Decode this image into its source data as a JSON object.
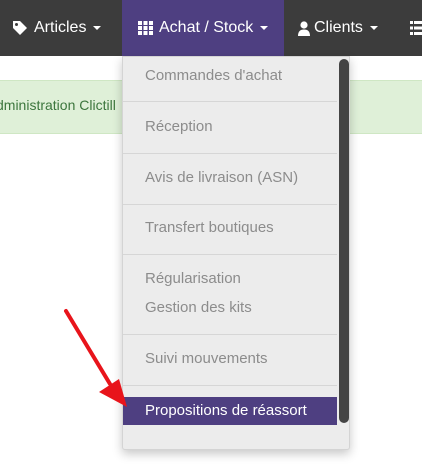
{
  "navbar": {
    "items": [
      {
        "label": "Articles",
        "icon": "tag-icon"
      },
      {
        "label": "Achat / Stock",
        "icon": "grid-icon",
        "active": true
      },
      {
        "label": "Clients",
        "icon": "user-icon"
      },
      {
        "label": "",
        "icon": "list-icon"
      }
    ]
  },
  "alert": {
    "text": "dministration Clictill"
  },
  "dropdown": {
    "items": [
      {
        "label": "Commandes d'achat"
      },
      {
        "label": "Réception"
      },
      {
        "label": "Avis de livraison (ASN)"
      },
      {
        "label": "Transfert boutiques"
      },
      {
        "label": "Régularisation"
      },
      {
        "label": "Gestion des kits"
      },
      {
        "label": "Suivi mouvements"
      },
      {
        "label": "Propositions de réassort",
        "active": true
      }
    ]
  },
  "colors": {
    "navbar_bg": "#3c3c3c",
    "accent": "#4e3f81",
    "alert_bg": "#dff0d8",
    "alert_text": "#3c763d",
    "arrow": "#e8141b"
  }
}
